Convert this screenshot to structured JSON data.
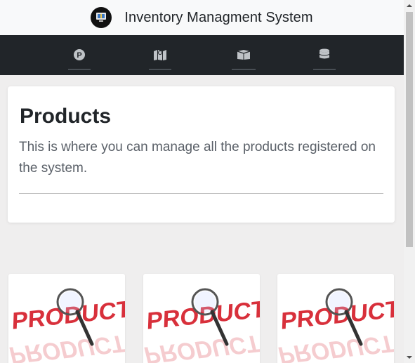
{
  "app": {
    "title": "Inventory Managment System",
    "logo_icon": "monitor-logo-icon"
  },
  "nav": {
    "items": [
      {
        "icon": "parking-icon"
      },
      {
        "icon": "map-icon"
      },
      {
        "icon": "box-icon"
      },
      {
        "icon": "database-icon"
      }
    ]
  },
  "header_card": {
    "title": "Products",
    "description": "This is where you can manage all the products registered on the system."
  },
  "products": [
    {
      "image_text": "PRODUCT"
    },
    {
      "image_text": "PRODUCT"
    },
    {
      "image_text": "PRODUCT"
    }
  ],
  "colors": {
    "navbar_dark": "#212529",
    "brandbar": "#f8f9fa",
    "page_bg": "#efeeee",
    "product_red": "#d8303b"
  }
}
